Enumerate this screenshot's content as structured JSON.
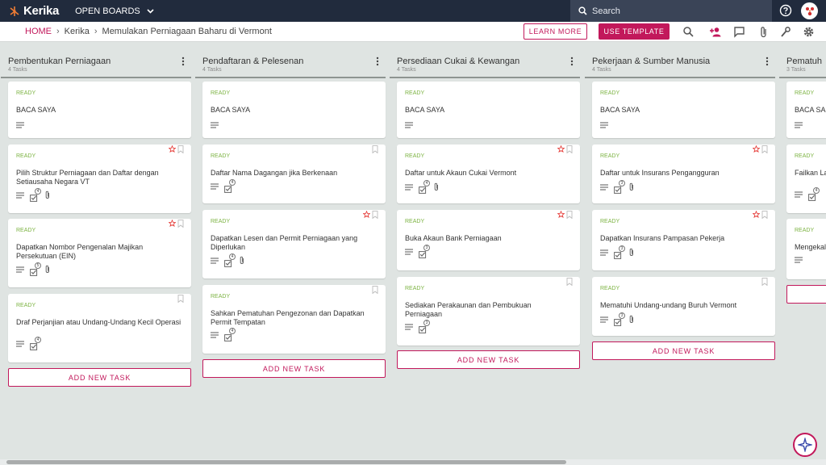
{
  "app": {
    "name": "Kerika",
    "open_boards": "OPEN BOARDS"
  },
  "search": {
    "placeholder": "Search"
  },
  "breadcrumb": {
    "home": "HOME",
    "org": "Kerika",
    "board": "Memulakan Perniagaan Baharu di Vermont"
  },
  "toolbar": {
    "learn_more": "LEARN MORE",
    "use_template": "USE TEMPLATE"
  },
  "columns": [
    {
      "title": "Pembentukan Perniagaan",
      "count": "4 Tasks",
      "cards": [
        {
          "status": "READY",
          "title": "BACA SAYA",
          "checklist": ""
        },
        {
          "status": "READY",
          "title": "Pilih Struktur Perniagaan dan Daftar dengan Setiausaha Negara VT",
          "checklist": "4"
        },
        {
          "status": "READY",
          "title": "Dapatkan Nombor Pengenalan Majikan Persekutuan (EIN)",
          "checklist": "5"
        },
        {
          "status": "READY",
          "title": "Draf Perjanjian atau Undang-Undang Kecil Operasi",
          "checklist": "4"
        }
      ]
    },
    {
      "title": "Pendaftaran & Pelesenan",
      "count": "4 Tasks",
      "cards": [
        {
          "status": "READY",
          "title": "BACA SAYA",
          "checklist": ""
        },
        {
          "status": "READY",
          "title": "Daftar Nama Dagangan jika Berkenaan",
          "checklist": "4"
        },
        {
          "status": "READY",
          "title": "Dapatkan Lesen dan Permit Perniagaan yang Diperlukan",
          "checklist": "4"
        },
        {
          "status": "READY",
          "title": "Sahkan Pematuhan Pengezonan dan Dapatkan Permit Tempatan",
          "checklist": "4"
        }
      ]
    },
    {
      "title": "Persediaan Cukai & Kewangan",
      "count": "4 Tasks",
      "cards": [
        {
          "status": "READY",
          "title": "BACA SAYA",
          "checklist": ""
        },
        {
          "status": "READY",
          "title": "Daftar untuk Akaun Cukai Vermont",
          "checklist": "4"
        },
        {
          "status": "READY",
          "title": "Buka Akaun Bank Perniagaan",
          "checklist": "3"
        },
        {
          "status": "READY",
          "title": "Sediakan Perakaunan dan Pembukuan Perniagaan",
          "checklist": "3"
        }
      ]
    },
    {
      "title": "Pekerjaan & Sumber Manusia",
      "count": "4 Tasks",
      "cards": [
        {
          "status": "READY",
          "title": "BACA SAYA",
          "checklist": ""
        },
        {
          "status": "READY",
          "title": "Daftar untuk Insurans Pengangguran",
          "checklist": "3"
        },
        {
          "status": "READY",
          "title": "Dapatkan Insurans Pampasan Pekerja",
          "checklist": "3"
        },
        {
          "status": "READY",
          "title": "Mematuhi Undang-undang Buruh Vermont",
          "checklist": "3"
        }
      ]
    },
    {
      "title": "Pematuh",
      "count": "3 Tasks",
      "cards": [
        {
          "status": "READY",
          "title": "BACA SA",
          "checklist": ""
        },
        {
          "status": "READY",
          "title": "Failkan La Negara V",
          "checklist": "4"
        },
        {
          "status": "READY",
          "title": "Mengekal",
          "checklist": ""
        }
      ]
    }
  ],
  "add_task_label": "ADD NEW TASK",
  "colors": {
    "accent": "#c2185b",
    "topbar": "#212b3d",
    "ready": "#7cb342",
    "board_bg": "#dfe4e2",
    "star": "#e53935"
  }
}
